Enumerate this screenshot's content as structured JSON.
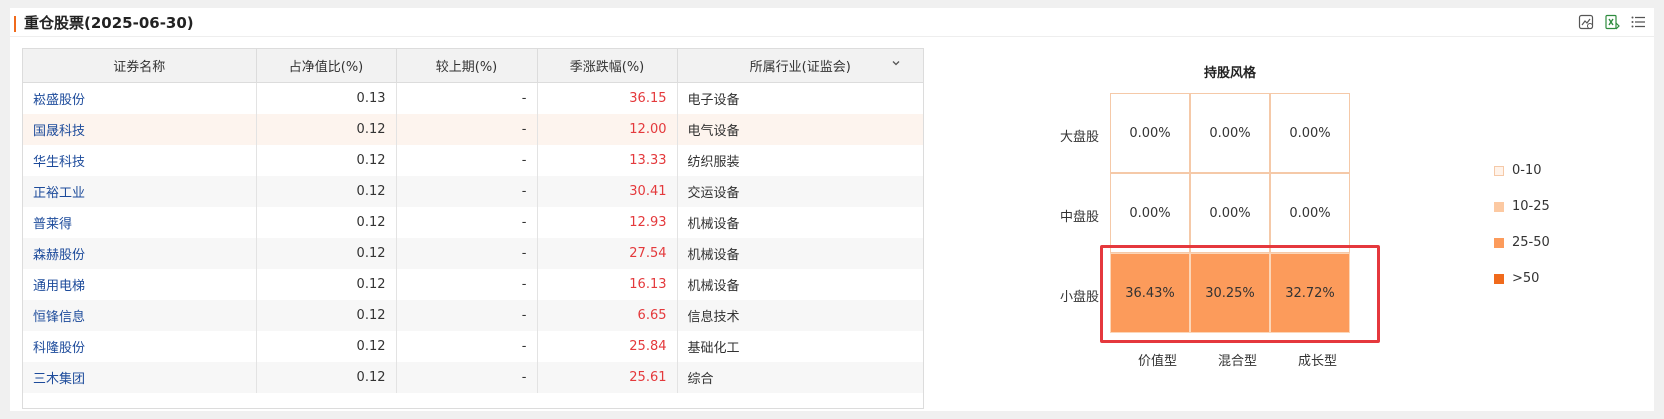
{
  "header": {
    "title": "重仓股票(2025-06-30)",
    "accent_color": "#f06a1c",
    "tools": [
      "chart-settings-icon",
      "excel-export-icon",
      "list-menu-icon"
    ]
  },
  "table": {
    "columns": [
      "证券名称",
      "占净值比(%)",
      "较上期(%)",
      "季涨跌幅(%)",
      "所属行业(证监会)"
    ],
    "rows": [
      {
        "name": "崧盛股份",
        "ratio": "0.13",
        "change": "-",
        "quarter": "36.15",
        "industry": "电子设备"
      },
      {
        "name": "国晟科技",
        "ratio": "0.12",
        "change": "-",
        "quarter": "12.00",
        "industry": "电气设备"
      },
      {
        "name": "华生科技",
        "ratio": "0.12",
        "change": "-",
        "quarter": "13.33",
        "industry": "纺织服装"
      },
      {
        "name": "正裕工业",
        "ratio": "0.12",
        "change": "-",
        "quarter": "30.41",
        "industry": "交运设备"
      },
      {
        "name": "普莱得",
        "ratio": "0.12",
        "change": "-",
        "quarter": "12.93",
        "industry": "机械设备"
      },
      {
        "name": "森赫股份",
        "ratio": "0.12",
        "change": "-",
        "quarter": "27.54",
        "industry": "机械设备"
      },
      {
        "name": "通用电梯",
        "ratio": "0.12",
        "change": "-",
        "quarter": "16.13",
        "industry": "机械设备"
      },
      {
        "name": "恒锋信息",
        "ratio": "0.12",
        "change": "-",
        "quarter": "6.65",
        "industry": "信息技术"
      },
      {
        "name": "科隆股份",
        "ratio": "0.12",
        "change": "-",
        "quarter": "25.84",
        "industry": "基础化工"
      },
      {
        "name": "三木集团",
        "ratio": "0.12",
        "change": "-",
        "quarter": "25.61",
        "industry": "综合"
      }
    ],
    "positive_color": "#e4393c",
    "link_color": "#1d4b9b"
  },
  "style_box": {
    "title": "持股风格",
    "rows": [
      "大盘股",
      "中盘股",
      "小盘股"
    ],
    "cols": [
      "价值型",
      "混合型",
      "成长型"
    ],
    "values": [
      [
        "0.00%",
        "0.00%",
        "0.00%"
      ],
      [
        "0.00%",
        "0.00%",
        "0.00%"
      ],
      [
        "36.43%",
        "30.25%",
        "32.72%"
      ]
    ],
    "legend": [
      {
        "label": "0-10",
        "color": "#fff3ea",
        "border": "#f5c9a8"
      },
      {
        "label": "10-25",
        "color": "#fcc9a2",
        "border": "#fcc9a2"
      },
      {
        "label": "25-50",
        "color": "#fc9b5b",
        "border": "#fc9b5b"
      },
      {
        "label": ">50",
        "color": "#f06a1c",
        "border": "#f06a1c"
      }
    ],
    "highlight_color": "#e5383d"
  }
}
